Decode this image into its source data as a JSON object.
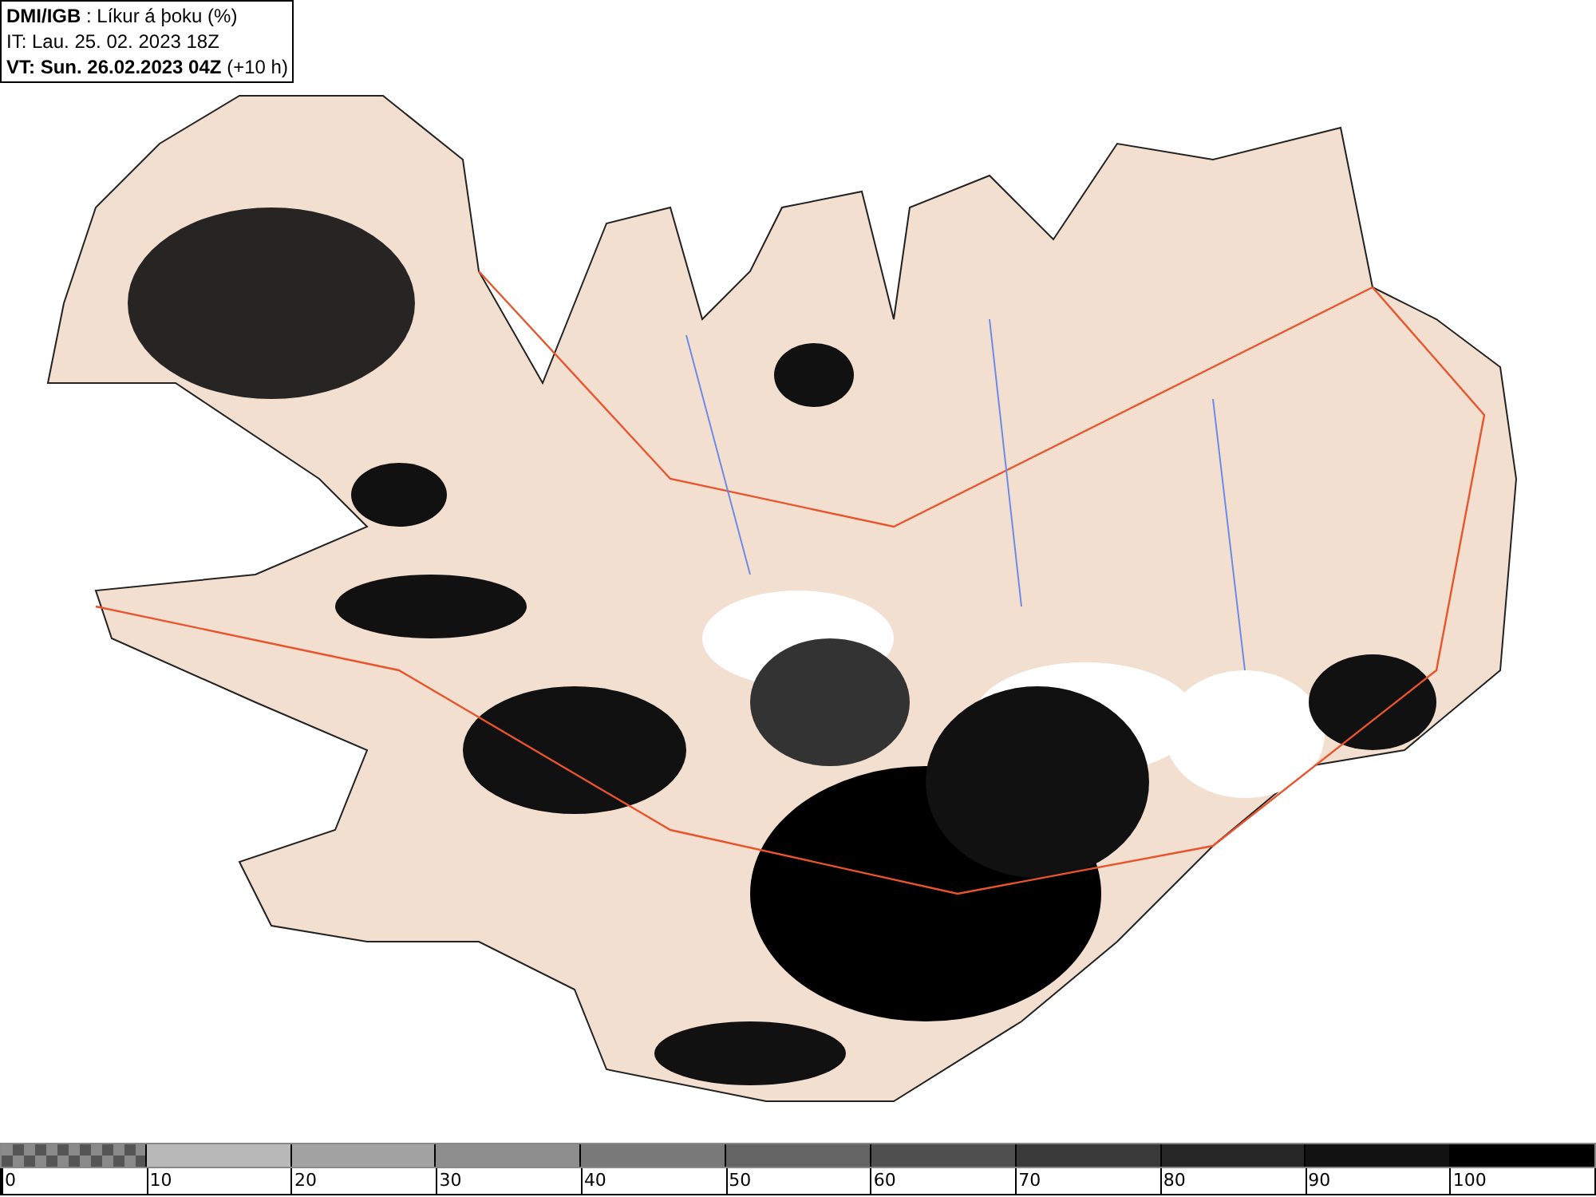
{
  "header": {
    "lines": [
      "**DMI/IGB** : Líkur á þoku (%)",
      "IT: Lau. 25. 02. 2023 18Z",
      "**VT: Sun. 26.02.2023 04Z** (+10 h)"
    ]
  },
  "legend": {
    "segments": [
      {
        "kind": "checker"
      },
      {
        "kind": "solid",
        "color": "#b8b8b8"
      },
      {
        "kind": "solid",
        "color": "#a3a3a3"
      },
      {
        "kind": "solid",
        "color": "#8e8e8e"
      },
      {
        "kind": "solid",
        "color": "#797979"
      },
      {
        "kind": "solid",
        "color": "#646464"
      },
      {
        "kind": "solid",
        "color": "#4f4f4f"
      },
      {
        "kind": "solid",
        "color": "#3a3a3a"
      },
      {
        "kind": "solid",
        "color": "#262626"
      },
      {
        "kind": "solid",
        "color": "#121212"
      },
      {
        "kind": "solid",
        "color": "#000000"
      }
    ],
    "labels": [
      "0",
      "10",
      "20",
      "30",
      "40",
      "50",
      "60",
      "70",
      "80",
      "90",
      "100"
    ]
  }
}
